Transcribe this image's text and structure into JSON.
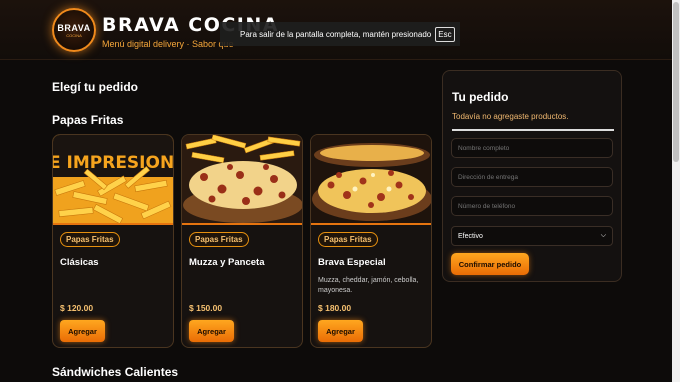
{
  "header": {
    "brand": "BRAVA COCINA",
    "tagline": "Menú digital delivery · Sabor que",
    "logo_text": "BRAVA",
    "logo_sub": "COCINA"
  },
  "fullscreen_notice": {
    "text": "Para salir de la pantalla completa, mantén presionado",
    "key": "Esc"
  },
  "main": {
    "heading": "Elegí tu pedido",
    "categories": [
      {
        "name": "Papas Fritas",
        "items": [
          {
            "tag": "Papas Fritas",
            "title": "Clásicas",
            "desc": "",
            "price": "$ 120.00",
            "button": "Agregar",
            "banner_text": "E IMPRESIONA"
          },
          {
            "tag": "Papas Fritas",
            "title": "Muzza y Panceta",
            "desc": "",
            "price": "$ 150.00",
            "button": "Agregar"
          },
          {
            "tag": "Papas Fritas",
            "title": "Brava Especial",
            "desc": "Muzza, cheddar, jamón, cebolla, mayonesa.",
            "price": "$ 180.00",
            "button": "Agregar"
          }
        ]
      },
      {
        "name": "Sándwiches Calientes"
      }
    ]
  },
  "order_panel": {
    "title": "Tu pedido",
    "empty_message": "Todavía no agregaste productos.",
    "name_placeholder": "Nombre completo",
    "address_placeholder": "Dirección de entrega",
    "phone_placeholder": "Número de teléfono",
    "payment_selected": "Efectivo",
    "confirm_label": "Confirmar pedido"
  },
  "colors": {
    "accent": "#f08a1c",
    "background": "#0d0b0a",
    "price": "#f5c070"
  }
}
